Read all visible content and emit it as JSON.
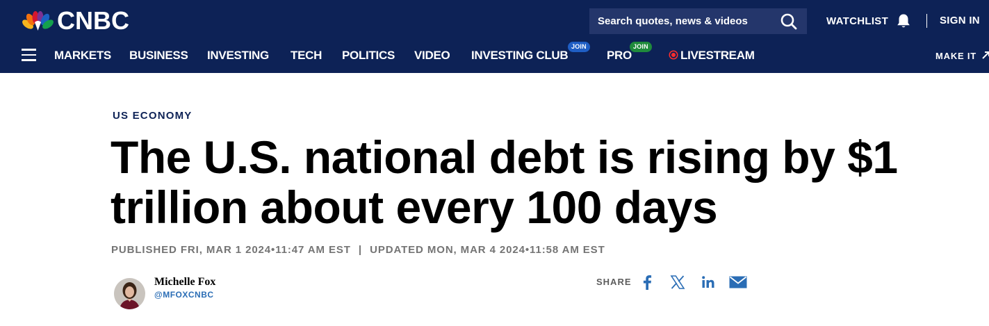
{
  "header": {
    "logo_text": "CNBC",
    "search_placeholder": "Search quotes, news & videos",
    "watchlist_label": "WATCHLIST",
    "signin_label": "SIGN IN",
    "make_it_label": "MAKE IT"
  },
  "nav": {
    "items": [
      {
        "label": "MARKETS"
      },
      {
        "label": "BUSINESS"
      },
      {
        "label": "INVESTING"
      },
      {
        "label": "TECH"
      },
      {
        "label": "POLITICS"
      },
      {
        "label": "VIDEO"
      },
      {
        "label": "INVESTING CLUB",
        "badge": "JOIN",
        "badge_color": "#1f5ec4"
      },
      {
        "label": "PRO",
        "badge": "JOIN",
        "badge_color": "#1f8a3c"
      },
      {
        "label": "LIVESTREAM"
      }
    ]
  },
  "article": {
    "section": "US ECONOMY",
    "headline": "The U.S. national debt is rising by $1 trillion about every 100 days",
    "published": "PUBLISHED FRI, MAR 1 2024•11:47 AM EST",
    "separator": "|",
    "updated": "UPDATED MON, MAR 4 2024•11:58 AM EST",
    "author_name": "Michelle Fox",
    "author_handle": "@MFOXCNBC",
    "share_label": "SHARE"
  },
  "colors": {
    "header_bg": "#0d2256",
    "section_label": "#0d2256",
    "handle": "#2a6db5",
    "share_icons": "#2a6db5",
    "live_dot": "#ff2d2d"
  },
  "icons": [
    "peacock-logo-icon",
    "search-icon",
    "bell-icon",
    "hamburger-menu-icon",
    "live-dot-icon",
    "arrow-icon",
    "facebook-icon",
    "x-icon",
    "linkedin-icon",
    "email-icon"
  ]
}
